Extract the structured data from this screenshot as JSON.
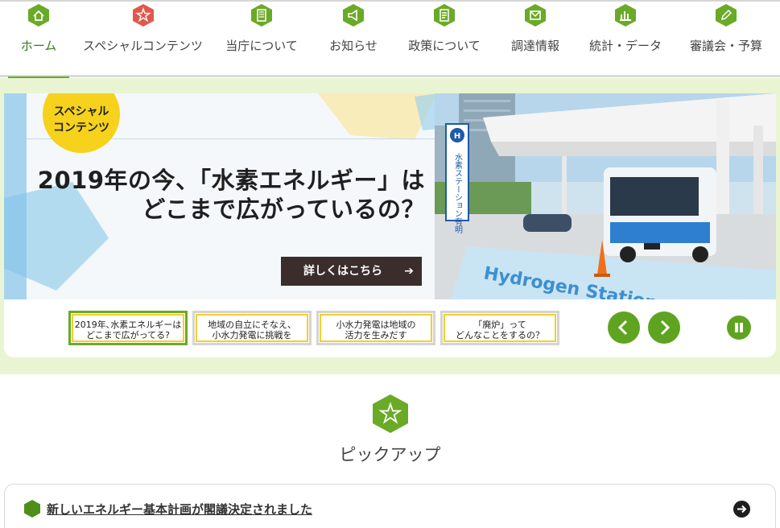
{
  "nav": {
    "items": [
      {
        "label": "ホーム",
        "icon": "home-icon",
        "color": "#6aaa27",
        "active": true
      },
      {
        "label": "スペシャルコンテンツ",
        "icon": "star-icon",
        "color": "#e0584b",
        "active": false
      },
      {
        "label": "当庁について",
        "icon": "building-icon",
        "color": "#6aaa27",
        "active": false
      },
      {
        "label": "お知らせ",
        "icon": "megaphone-icon",
        "color": "#6aaa27",
        "active": false
      },
      {
        "label": "政策について",
        "icon": "document-icon",
        "color": "#6aaa27",
        "active": false
      },
      {
        "label": "調達情報",
        "icon": "mail-icon",
        "color": "#6aaa27",
        "active": false
      },
      {
        "label": "統計・データ",
        "icon": "bar-chart-icon",
        "color": "#6aaa27",
        "active": false
      },
      {
        "label": "審議会・予算",
        "icon": "pencil-icon",
        "color": "#6aaa27",
        "active": false
      }
    ]
  },
  "slider": {
    "badge_line1": "スペシャル",
    "badge_line2": "コンテンツ",
    "headline_line1": "2019年の今、「水素エネルギー」は",
    "headline_line2": "どこまで広がっているの？",
    "more_label": "詳しくはこちら",
    "photo_sign": "水素ステーション有明",
    "photo_ground_text": "Hydrogen Station",
    "thumbnails": [
      {
        "line1": "2019年､水素エネルギーは",
        "line2": "どこまで広がってる?",
        "active": true
      },
      {
        "line1": "地域の自立にそなえ、",
        "line2": "小水力発電に挑戦を",
        "active": false
      },
      {
        "line1": "小水力発電は地域の",
        "line2": "活力を生みだす",
        "active": false
      },
      {
        "line1": "「廃炉」って",
        "line2": "どんなことをするの？",
        "active": false
      }
    ]
  },
  "pickup": {
    "title": "ピックアップ",
    "items": [
      {
        "label": "新しいエネルギー基本計画が閣議決定されました"
      }
    ]
  },
  "colors": {
    "accent_green": "#6aaa27",
    "band_green": "#e9f5d2",
    "badge_yellow": "#f6d21c",
    "button_dark": "#3a2d2b",
    "special_red": "#e0584b"
  }
}
